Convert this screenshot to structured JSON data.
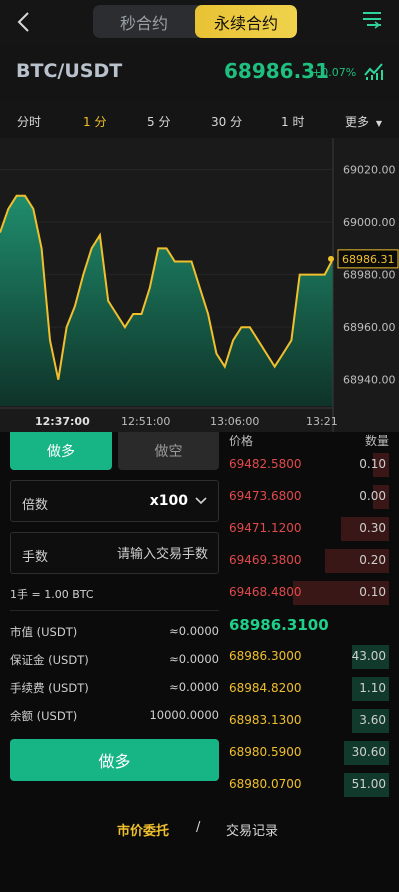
{
  "header": {
    "tabs": [
      {
        "label": "秒合约",
        "active": false
      },
      {
        "label": "永续合约",
        "active": true
      }
    ]
  },
  "ticker": {
    "pair": "BTC/USDT",
    "price": "68986.31",
    "change": "+0.07%"
  },
  "timeframes": [
    {
      "label": "分时",
      "selected": false
    },
    {
      "label": "1 分",
      "selected": true
    },
    {
      "label": "5 分",
      "selected": false
    },
    {
      "label": "30 分",
      "selected": false
    },
    {
      "label": "1 时",
      "selected": false
    },
    {
      "label": "更多",
      "selected": false
    }
  ],
  "chart_data": {
    "type": "area",
    "y_ticks": [
      "69020.00",
      "69000.00",
      "68980.00",
      "68960.00",
      "68940.00"
    ],
    "x_ticks": [
      "12:37:00",
      "12:51:00",
      "13:06:00",
      "13:21"
    ],
    "last_price_label": "68986.31",
    "ylim": [
      68930,
      69032
    ],
    "values": [
      68996,
      69005,
      69010,
      69010,
      69005,
      68990,
      68955,
      68940,
      68960,
      68968,
      68980,
      68990,
      68995,
      68970,
      68965,
      68960,
      68965,
      68965,
      68975,
      68990,
      68990,
      68985,
      68985,
      68985,
      68975,
      68965,
      68950,
      68945,
      68955,
      68960,
      68960,
      68955,
      68950,
      68945,
      68950,
      68955,
      68980,
      68980,
      68980,
      68980,
      68986
    ],
    "line_color": "#f0c02c",
    "fill_top": "#1f8d6c",
    "fill_bottom": "#0f3329"
  },
  "trade": {
    "long_tab": "做多",
    "short_tab": "做空",
    "leverage_label": "倍数",
    "leverage_value": "x100",
    "qty_label": "手数",
    "qty_placeholder": "请输入交易手数",
    "lot_note": "1手 = 1.00 BTC",
    "info": [
      {
        "k": "市值 (USDT)",
        "v": "≈0.0000"
      },
      {
        "k": "保证金 (USDT)",
        "v": "≈0.0000"
      },
      {
        "k": "手续费 (USDT)",
        "v": "≈0.0000"
      },
      {
        "k": "余额 (USDT)",
        "v": "10000.0000"
      }
    ],
    "submit": "做多"
  },
  "orderbook": {
    "price_header": "价格",
    "qty_header": "数量",
    "asks": [
      {
        "price": "69482.5800",
        "qty": "0.10",
        "depth": 0.1
      },
      {
        "price": "69473.6800",
        "qty": "0.00",
        "depth": 0.1
      },
      {
        "price": "69471.1200",
        "qty": "0.30",
        "depth": 0.3
      },
      {
        "price": "69469.3800",
        "qty": "0.20",
        "depth": 0.4
      },
      {
        "price": "69468.4800",
        "qty": "0.10",
        "depth": 0.6
      }
    ],
    "mid_price": "68986.3100",
    "bids": [
      {
        "price": "68986.3000",
        "qty": "43.00",
        "depth": 0.23
      },
      {
        "price": "68984.8200",
        "qty": "1.10",
        "depth": 0.23
      },
      {
        "price": "68983.1300",
        "qty": "3.60",
        "depth": 0.23
      },
      {
        "price": "68980.5900",
        "qty": "30.60",
        "depth": 0.28
      },
      {
        "price": "68980.0700",
        "qty": "51.00",
        "depth": 0.28
      }
    ]
  },
  "footer": {
    "market_order": "市价委托",
    "sep": "/",
    "history": "交易记录"
  }
}
